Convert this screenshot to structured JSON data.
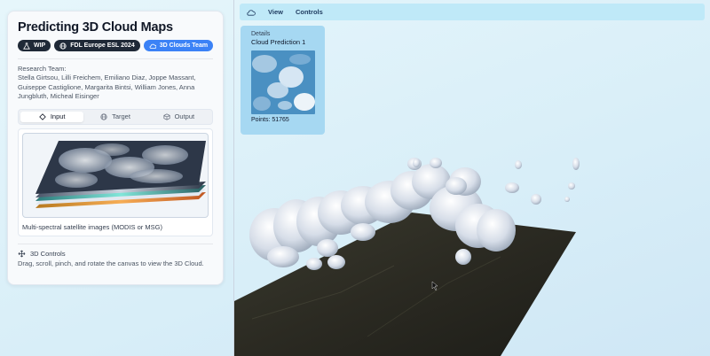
{
  "panel": {
    "title": "Predicting 3D Cloud Maps",
    "badges": [
      {
        "label": "WIP",
        "icon": "flask-icon"
      },
      {
        "label": "FDL Europe ESL 2024",
        "icon": "globe-icon"
      },
      {
        "label": "3D Clouds Team",
        "icon": "cloud-icon"
      }
    ],
    "team_label": "Research Team:",
    "team_names": "Stella Girtsou, Lilli Freichem, Emiliano Diaz, Joppe Massant, Guiseppe Castiglione, Margarita Bintsi, William Jones, Anna Jungbluth, Micheal Eisinger",
    "tabs": [
      {
        "label": "Input",
        "icon": "diamond-icon",
        "active": true
      },
      {
        "label": "Target",
        "icon": "globe-icon",
        "active": false
      },
      {
        "label": "Output",
        "icon": "cube-icon",
        "active": false
      }
    ],
    "image_caption": "Multi-spectral satellite images (MODIS or MSG)",
    "controls_title": "3D Controls",
    "controls_desc": "Drag, scroll, pinch, and rotate the canvas to view the 3D Cloud."
  },
  "menubar": {
    "icon": "cloud-icon",
    "items": [
      "View",
      "Controls"
    ]
  },
  "details": {
    "label": "Details",
    "name": "Cloud Prediction 1",
    "points": "Points: 51765"
  },
  "colors": {
    "accent": "#3b82f6",
    "badge_dark": "#1f2937",
    "menubar_bg": "#bfe9f8",
    "details_bg": "#a6d8f2"
  }
}
